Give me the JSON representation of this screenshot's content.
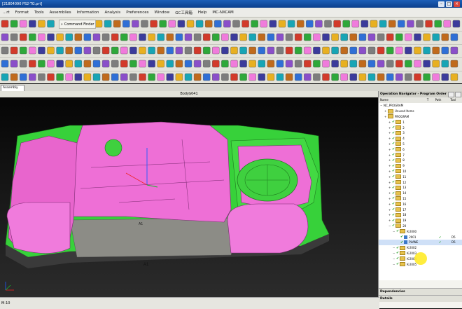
{
  "window": {
    "title": "[21804090 PS2-TG.prt]"
  },
  "menu": [
    "...rt",
    "Format",
    "Tools",
    "Assemblies",
    "Information",
    "Analysis",
    "Preferences",
    "Window",
    "GC工具箱",
    "Help",
    "MC-NXCAM"
  ],
  "toolbar": {
    "command_finder_label": "Command Finder"
  },
  "tabs": {
    "assembly": "Assembly"
  },
  "viewport": {
    "title": "Body$041",
    "label_a1": "A1",
    "label_a2": "A1"
  },
  "navigator": {
    "title": "Operation Navigator - Program Order",
    "columns": [
      "Name",
      "T",
      "Path",
      "Tool"
    ],
    "rows": [
      {
        "label": "NC_PROGRAM",
        "level": 0,
        "type": "root"
      },
      {
        "label": "Unused Items",
        "level": 1,
        "type": "folder"
      },
      {
        "label": "PROGRAM",
        "level": 1,
        "type": "folder"
      },
      {
        "label": "1",
        "level": 2,
        "type": "folder"
      },
      {
        "label": "2",
        "level": 2,
        "type": "folder"
      },
      {
        "label": "3",
        "level": 2,
        "type": "folder"
      },
      {
        "label": "4",
        "level": 2,
        "type": "folder"
      },
      {
        "label": "5",
        "level": 2,
        "type": "folder"
      },
      {
        "label": "6",
        "level": 2,
        "type": "folder"
      },
      {
        "label": "7",
        "level": 2,
        "type": "folder"
      },
      {
        "label": "8",
        "level": 2,
        "type": "folder"
      },
      {
        "label": "9",
        "level": 2,
        "type": "folder"
      },
      {
        "label": "10",
        "level": 2,
        "type": "folder"
      },
      {
        "label": "11",
        "level": 2,
        "type": "folder"
      },
      {
        "label": "12",
        "level": 2,
        "type": "folder"
      },
      {
        "label": "13",
        "level": 2,
        "type": "folder"
      },
      {
        "label": "14",
        "level": 2,
        "type": "folder"
      },
      {
        "label": "15",
        "level": 2,
        "type": "folder"
      },
      {
        "label": "16",
        "level": 2,
        "type": "folder"
      },
      {
        "label": "17",
        "level": 2,
        "type": "folder"
      },
      {
        "label": "18",
        "level": 2,
        "type": "folder"
      },
      {
        "label": "19",
        "level": 2,
        "type": "folder"
      },
      {
        "label": "20",
        "level": 2,
        "type": "folder"
      },
      {
        "label": "K-2000",
        "level": 3,
        "type": "folder"
      },
      {
        "label": "2001",
        "level": 4,
        "type": "op",
        "tool": "D5"
      },
      {
        "label": "PLANE",
        "level": 4,
        "type": "op",
        "tool": "D5",
        "selected": true
      },
      {
        "label": "K-2002",
        "level": 3,
        "type": "folder"
      },
      {
        "label": "K-2003",
        "level": 3,
        "type": "folder"
      },
      {
        "label": "K-2004",
        "level": 3,
        "type": "folder"
      },
      {
        "label": "K-2005",
        "level": 3,
        "type": "folder"
      }
    ],
    "dependencies": "Dependencies",
    "details": "Details"
  },
  "status": {
    "text": "M-10"
  },
  "colors": {
    "mold_pink": "#ee6fd6",
    "base_green": "#37d13a",
    "selection_blue": "#cfe0f7"
  }
}
